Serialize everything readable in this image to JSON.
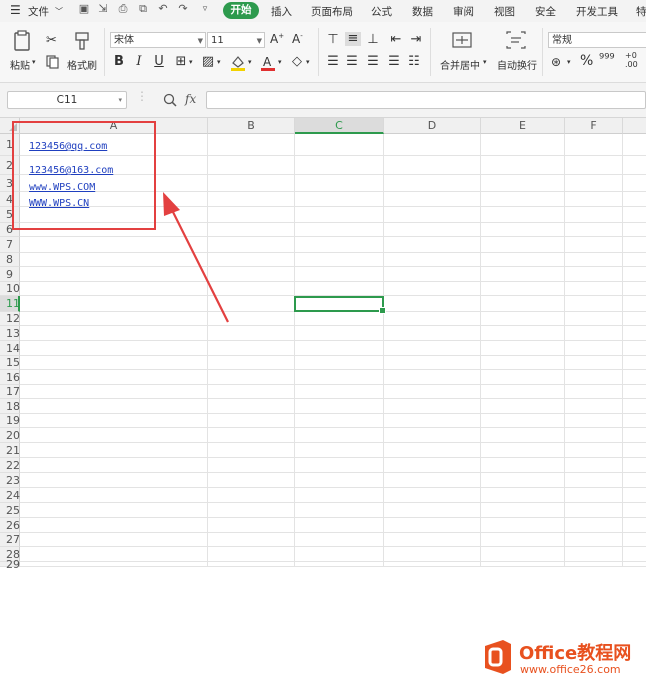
{
  "menubar": {
    "file_label": "文件",
    "tabs": [
      "开始",
      "插入",
      "页面布局",
      "公式",
      "数据",
      "审阅",
      "视图",
      "安全",
      "开发工具",
      "特"
    ]
  },
  "ribbon": {
    "paste_label": "粘贴",
    "format_painter_label": "格式刷",
    "font_name": "宋体",
    "font_size": "11",
    "merge_center_label": "合并居中",
    "wrap_text_label": "自动换行",
    "number_format": "常规",
    "accent_color": "#2d9a4d",
    "font_color_bar": "#e03030",
    "highlight_color_bar": "#f2d200"
  },
  "formula_bar": {
    "name_box": "C11",
    "fx_label": "fx",
    "formula_value": ""
  },
  "sheet": {
    "columns": [
      "A",
      "B",
      "C",
      "D",
      "E",
      "F"
    ],
    "rows": [
      "1",
      "2",
      "3",
      "4",
      "5",
      "6",
      "7",
      "8",
      "9",
      "10",
      "11",
      "12",
      "13",
      "14",
      "15",
      "16",
      "17",
      "18",
      "19",
      "20",
      "21",
      "22",
      "23",
      "24",
      "25",
      "26",
      "27",
      "28",
      "29"
    ],
    "selected_cell": "C11",
    "cells": {
      "A1": "123456@qq.com",
      "A2": "123456@163.com",
      "A3": "www.WPS.COM",
      "A4": "WWW.WPS.CN"
    }
  },
  "watermark": {
    "brand": "Office教程网",
    "url": "www.office26.com",
    "brand_color": "#e8511f"
  }
}
